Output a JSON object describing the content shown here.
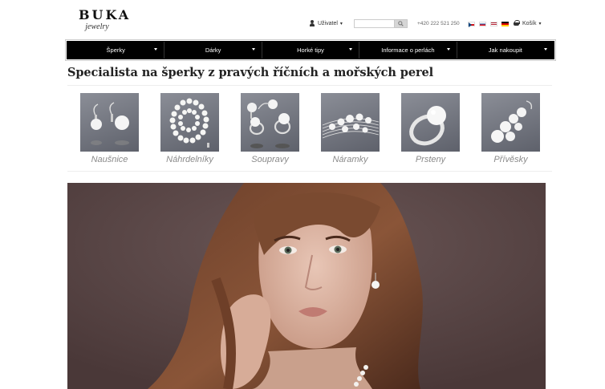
{
  "header": {
    "logo_main": "BUKA",
    "logo_sub": "jewelry",
    "user_label": "Uživatel",
    "search_placeholder": "",
    "phone": "+420 222 521 250",
    "flags": [
      "cz",
      "sk",
      "en",
      "de"
    ],
    "cart_label": "Košík"
  },
  "nav": {
    "items": [
      {
        "label": "Šperky"
      },
      {
        "label": "Dárky"
      },
      {
        "label": "Horké tipy"
      },
      {
        "label": "Informace o perlách"
      },
      {
        "label": "Jak nakoupit"
      }
    ]
  },
  "main": {
    "title": "Specialista na šperky z pravých říčních a mořských perel",
    "categories": [
      {
        "label": "Naušnice",
        "icon": "earrings-image"
      },
      {
        "label": "Náhrdelníky",
        "icon": "necklace-image"
      },
      {
        "label": "Soupravy",
        "icon": "jewelry-set-image"
      },
      {
        "label": "Náramky",
        "icon": "bracelet-image"
      },
      {
        "label": "Prsteny",
        "icon": "ring-image"
      },
      {
        "label": "Přívěsky",
        "icon": "pendant-image"
      }
    ]
  },
  "colors": {
    "nav_bg": "#000000",
    "category_bg": "#6b6e78",
    "category_label": "#8a8a8a",
    "hero_bg": "#5c4747"
  }
}
